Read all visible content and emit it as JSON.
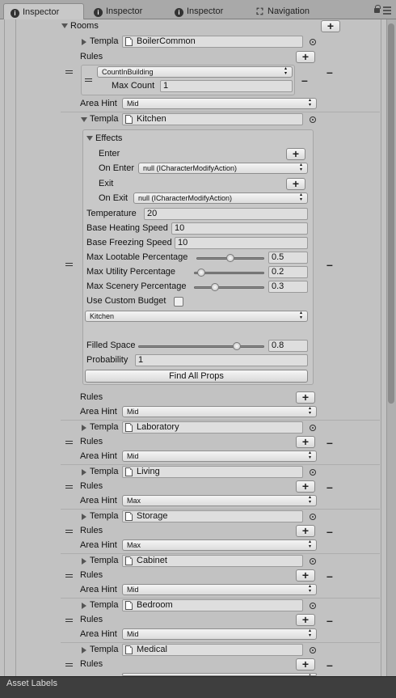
{
  "tabs": [
    {
      "label": "Inspector"
    },
    {
      "label": "Inspector"
    },
    {
      "label": "Inspector"
    },
    {
      "label": "Navigation"
    }
  ],
  "rooms_label": "Rooms",
  "template_label": "Templa",
  "rules_label": "Rules",
  "area_hint_label": "Area Hint",
  "boiler": {
    "template": "BoilerCommon",
    "rule_type": "CountInBuilding",
    "max_count_label": "Max Count",
    "max_count": "1",
    "area_hint": "Mid"
  },
  "kitchen": {
    "template": "Kitchen",
    "effects_label": "Effects",
    "enter_label": "Enter",
    "on_enter_label": "On Enter",
    "on_enter_value": "null (ICharacterModifyAction)",
    "exit_label": "Exit",
    "on_exit_label": "On Exit",
    "on_exit_value": "null (ICharacterModifyAction)",
    "temperature_label": "Temperature",
    "temperature": "20",
    "heating_label": "Base Heating Speed",
    "heating": "10",
    "freezing_label": "Base Freezing Speed",
    "freezing": "10",
    "lootable_label": "Max Lootable Percentage",
    "lootable": "0.5",
    "utility_label": "Max Utility Percentage",
    "utility": "0.2",
    "scenery_label": "Max Scenery Percentage",
    "scenery": "0.3",
    "custom_budget_label": "Use Custom Budget",
    "budget_value": "Kitchen",
    "filled_label": "Filled Space",
    "filled": "0.8",
    "probability_label": "Probability",
    "probability": "1",
    "find_props_label": "Find All Props",
    "area_hint": "Mid"
  },
  "rooms": [
    {
      "template": "Laboratory",
      "area_hint": "Mid"
    },
    {
      "template": "Living",
      "area_hint": "Max"
    },
    {
      "template": "Storage",
      "area_hint": "Max"
    },
    {
      "template": "Cabinet",
      "area_hint": "Mid"
    },
    {
      "template": "Bedroom",
      "area_hint": "Mid"
    },
    {
      "template": "Medical"
    }
  ],
  "footer": {
    "label": "Asset Labels"
  }
}
